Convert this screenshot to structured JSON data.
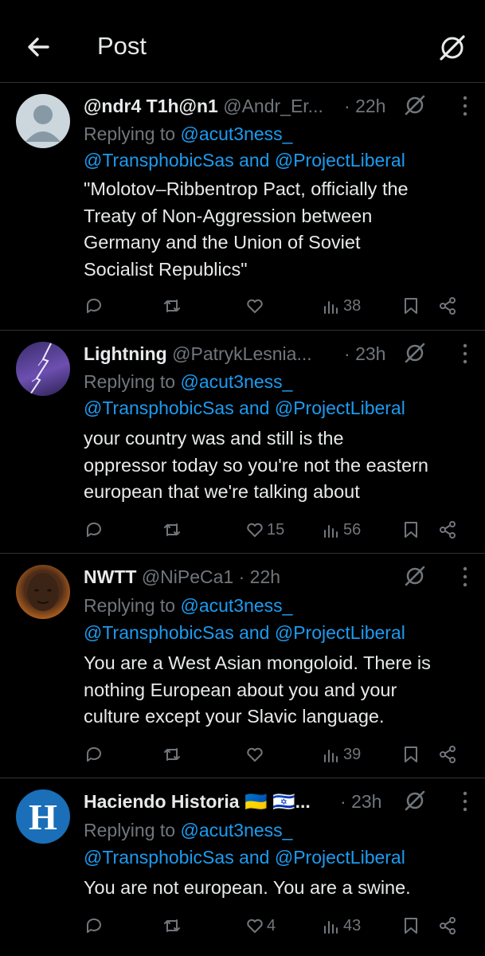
{
  "header": {
    "title": "Post"
  },
  "replying_label": "Replying to",
  "reply_to": {
    "first": "@acut3ness_",
    "second": "@TransphobicSas",
    "joiner": "and",
    "third": "@ProjectLiberal"
  },
  "posts": [
    {
      "name": "@ndr4 T1h@n1",
      "handle": "@Andr_Er...",
      "time": "22h",
      "text_lines": [
        "\"Molotov–Ribbentrop Pact, officially the",
        "Treaty of Non-Aggression between",
        "Germany and the Union of Soviet",
        "Socialist Republics\""
      ],
      "likes": "",
      "views": "38",
      "avatar": "default-avatar"
    },
    {
      "name": "Lightning",
      "handle": "@PatrykLesnia...",
      "time": "23h",
      "text_lines": [
        "your country was and still is the",
        "oppressor today so you're not the eastern",
        "european that we're talking about"
      ],
      "likes": "15",
      "views": "56",
      "avatar": "lightning-avatar"
    },
    {
      "name": "NWTT",
      "handle": "@NiPeCa1",
      "time": "22h",
      "text_lines": [
        "You are a West Asian mongoloid. There is",
        "nothing European about you and your",
        "culture except your Slavic language."
      ],
      "likes": "",
      "views": "39",
      "avatar": "person-avatar"
    },
    {
      "name": "Haciendo Historia",
      "flags": "🇺🇦 🇮🇱...",
      "handle": "",
      "time": "23h",
      "text_lines": [
        "You are not european. You are a swine."
      ],
      "likes": "4",
      "views": "43",
      "avatar": "h-logo-avatar",
      "avatar_letter": "H"
    }
  ]
}
